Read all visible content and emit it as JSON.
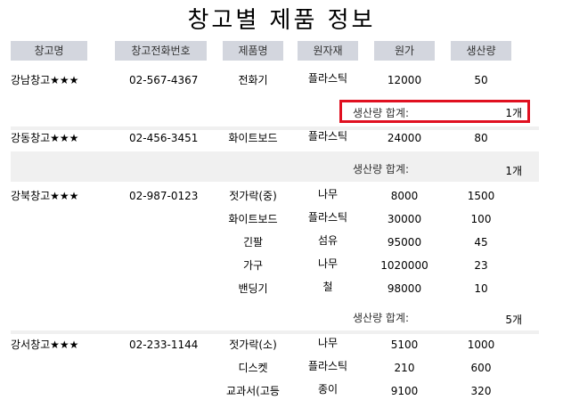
{
  "title": "창고별 제품 정보",
  "headers": [
    "창고명",
    "창고전화번호",
    "제품명",
    "원자재",
    "원가",
    "생산량"
  ],
  "groups": [
    {
      "warehouse": "강남창고★★★",
      "phone": "02-567-4367",
      "rows": [
        {
          "product": "전화기",
          "material": "플라스틱",
          "cost": "12000",
          "qty": "50"
        }
      ],
      "sum_label": "생산량 합계:",
      "sum_value": "1개"
    },
    {
      "warehouse": "강동창고★★★",
      "phone": "02-456-3451",
      "rows": [
        {
          "product": "화이트보드",
          "material": "플라스틱",
          "cost": "24000",
          "qty": "80"
        }
      ],
      "sum_label": "생산량 합계:",
      "sum_value": "1개"
    },
    {
      "warehouse": "강북창고★★★",
      "phone": "02-987-0123",
      "rows": [
        {
          "product": "젓가락(중)",
          "material": "나무",
          "cost": "8000",
          "qty": "1500"
        },
        {
          "product": "화이트보드",
          "material": "플라스틱",
          "cost": "30000",
          "qty": "100"
        },
        {
          "product": "긴팔",
          "material": "섬유",
          "cost": "95000",
          "qty": "45"
        },
        {
          "product": "가구",
          "material": "나무",
          "cost": "1020000",
          "qty": "23"
        },
        {
          "product": "밴딩기",
          "material": "철",
          "cost": "98000",
          "qty": "10"
        }
      ],
      "sum_label": "생산량 합계:",
      "sum_value": "5개"
    },
    {
      "warehouse": "강서창고★★★",
      "phone": "02-233-1144",
      "rows": [
        {
          "product": "젓가락(소)",
          "material": "나무",
          "cost": "5100",
          "qty": "1000"
        },
        {
          "product": "디스켓",
          "material": "플라스틱",
          "cost": "210",
          "qty": "600"
        },
        {
          "product": "교과서(고등",
          "material": "종이",
          "cost": "9100",
          "qty": "320"
        }
      ]
    }
  ],
  "highlight_color": "#e01020"
}
